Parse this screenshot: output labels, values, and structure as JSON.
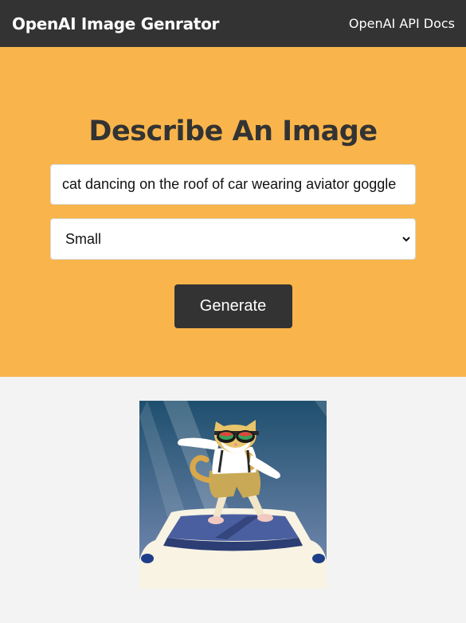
{
  "navbar": {
    "brand": "OpenAI Image Genrator",
    "docs_link": "OpenAI API Docs"
  },
  "showcase": {
    "title": "Describe An Image",
    "prompt_value": "cat dancing on the roof of car wearing aviator goggle",
    "size_selected": "Small",
    "generate_label": "Generate"
  },
  "result": {
    "image_alt_icon": "generated-image"
  },
  "colors": {
    "navbar_bg": "#333333",
    "showcase_bg": "#f9b54b",
    "page_bg": "#f3f3f3",
    "button_bg": "#333333"
  }
}
